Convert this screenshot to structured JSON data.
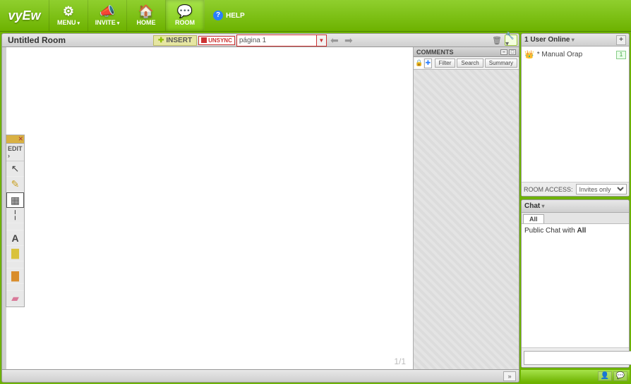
{
  "brand": "vyEw",
  "nav": {
    "menu": {
      "label": "MENU",
      "icon": "⚙"
    },
    "invite": {
      "label": "INVITE",
      "icon": "📣"
    },
    "home": {
      "label": "HOME",
      "icon": "🏠"
    },
    "room": {
      "label": "ROOM",
      "icon": "💬"
    }
  },
  "help": {
    "label": "HELP"
  },
  "room": {
    "title": "Untitled Room",
    "insert_label": "INSERT",
    "sync_label": "UNSYNC",
    "page_label": "página 1",
    "page_counter": "1/1"
  },
  "tools": {
    "header": "EDIT ›"
  },
  "comments": {
    "title": "COMMENTS",
    "filter": "Filter",
    "search": "Search",
    "summary": "Summary"
  },
  "users": {
    "header": "1 User Online",
    "list": [
      {
        "name": "* Manual Orap",
        "badge": "1"
      }
    ],
    "access_label": "ROOM ACCESS:",
    "access_value": "Invites only"
  },
  "chat": {
    "header": "Chat",
    "tab": "All",
    "body_prefix": "Public Chat with ",
    "body_bold": "All",
    "send_glyph": "↲"
  },
  "bottom": {
    "expand": "»"
  }
}
